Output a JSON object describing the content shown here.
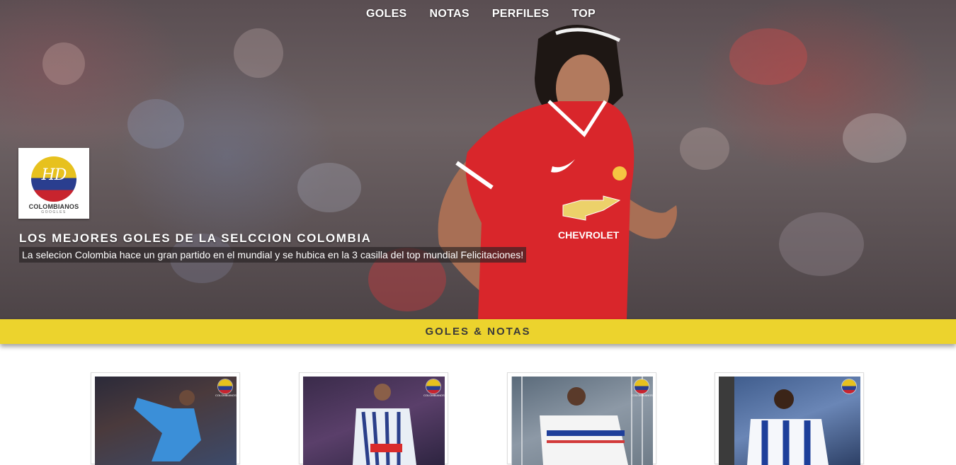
{
  "nav": {
    "items": [
      {
        "label": "GOLES"
      },
      {
        "label": "NOTAS"
      },
      {
        "label": "PERFILES"
      },
      {
        "label": "TOP"
      }
    ]
  },
  "logo": {
    "mark": "HD",
    "name": "COLOMBIANOS",
    "tagline": "GOOGLES"
  },
  "hero": {
    "title": "LOS MEJORES GOLES DE LA SELCCION COLOMBIA",
    "subtitle": "La selecion Colombia hace un gran partido en el mundial y se hubica en la 3 casilla del top mundial Felicitaciones!",
    "jersey_sponsor": "CHEVROLET"
  },
  "section": {
    "title": "GOLES & NOTAS"
  },
  "cards": [
    {
      "name": "card-1",
      "badge": "COLOMBIANOS"
    },
    {
      "name": "card-2",
      "badge": "COLOMBIANOS"
    },
    {
      "name": "card-3",
      "badge": "COLOMBIANOS"
    },
    {
      "name": "card-4",
      "badge": "COLOMBIANOS"
    }
  ],
  "colors": {
    "accent_band": "#ecd32d",
    "flag_yellow": "#e7c11e",
    "flag_blue": "#2a3e8f",
    "flag_red": "#c8242e"
  }
}
